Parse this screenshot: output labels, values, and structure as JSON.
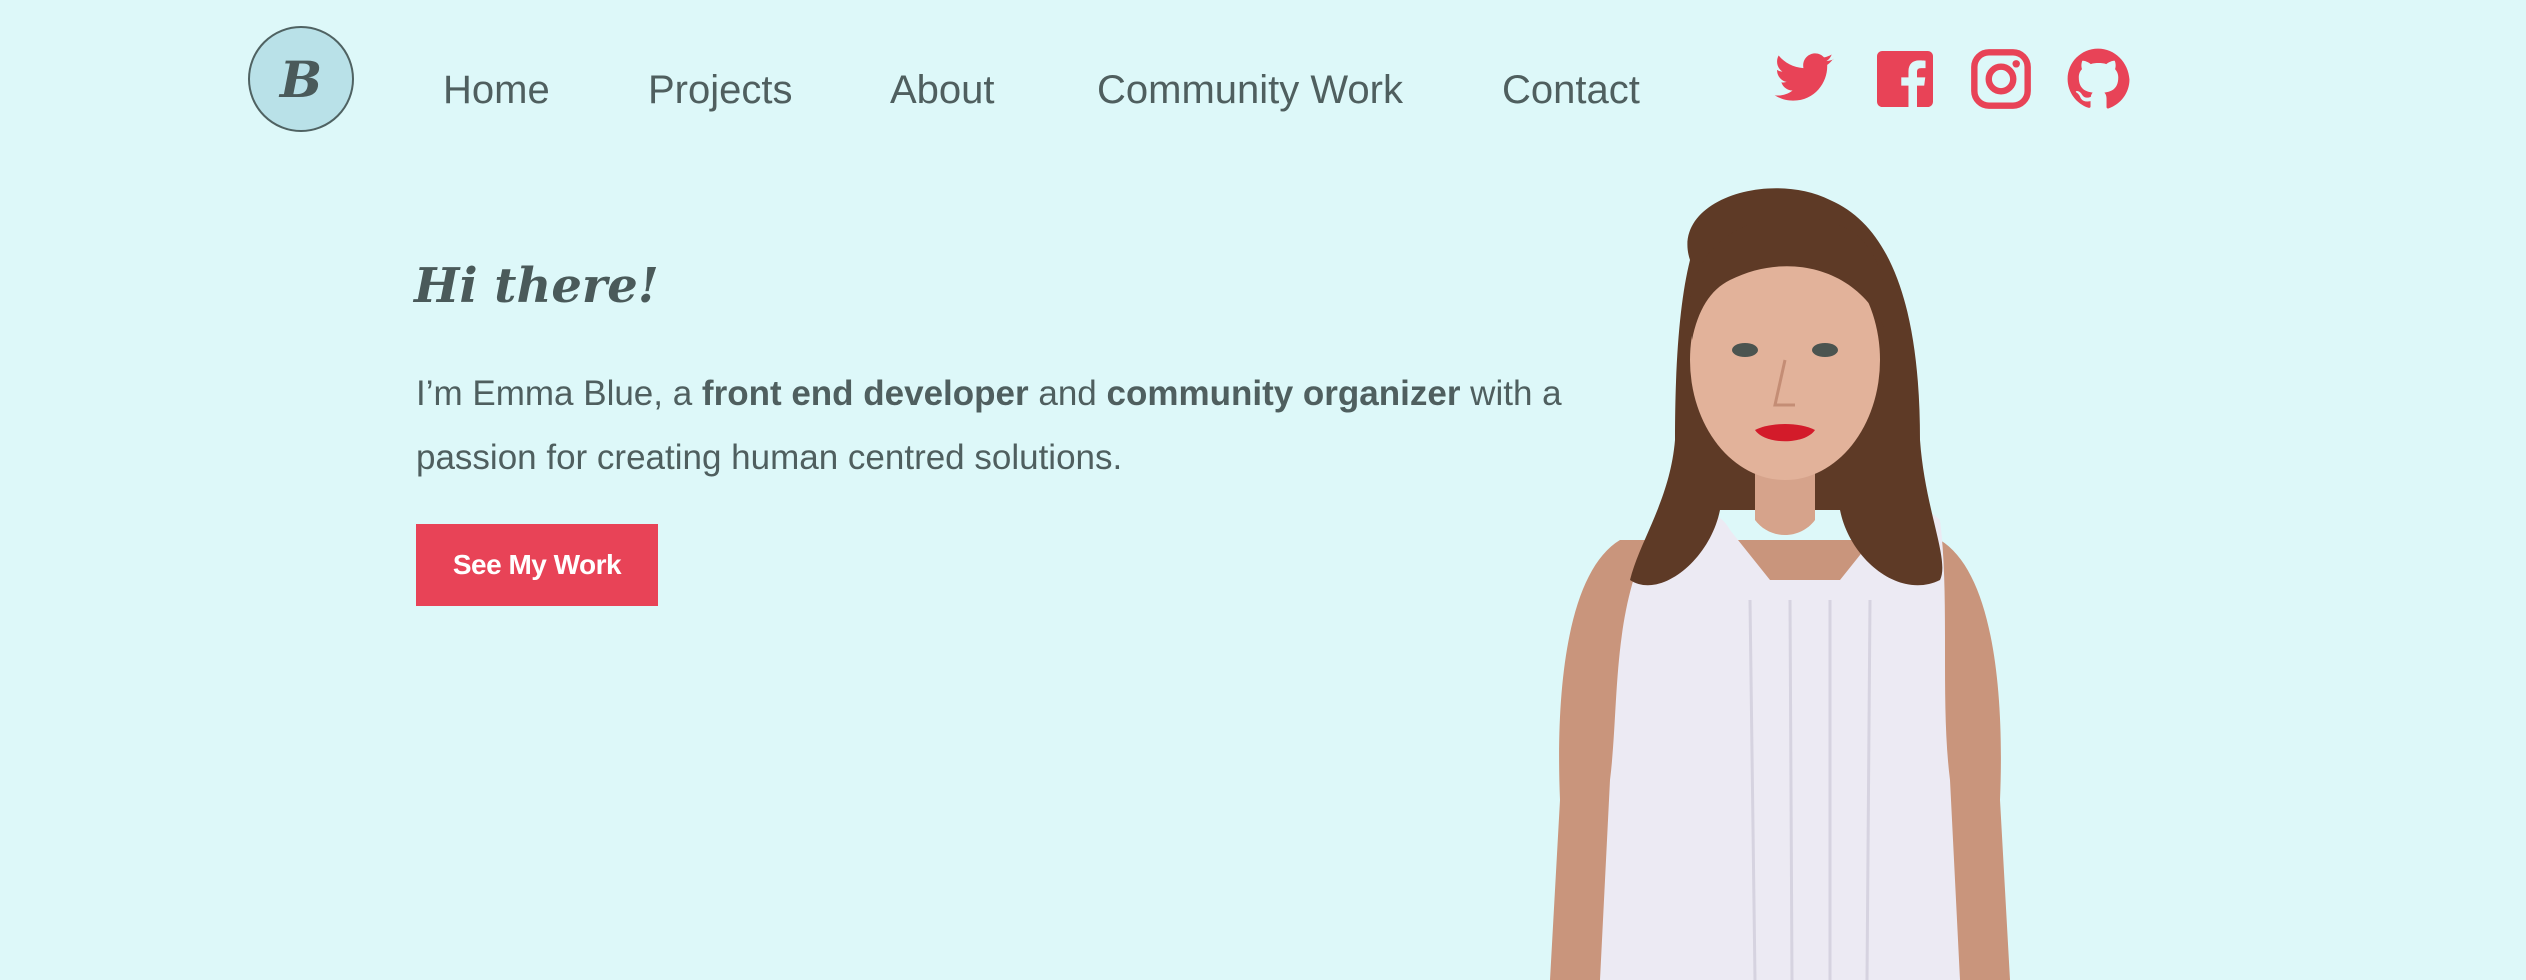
{
  "logo": {
    "letter": "B"
  },
  "nav": {
    "items": [
      {
        "label": "Home"
      },
      {
        "label": "Projects"
      },
      {
        "label": "About"
      },
      {
        "label": "Community Work"
      },
      {
        "label": "Contact"
      }
    ]
  },
  "social": {
    "accent_color": "#e84357",
    "icons": [
      "twitter-icon",
      "facebook-icon",
      "instagram-icon",
      "github-icon"
    ]
  },
  "hero": {
    "title": "Hi there!",
    "intro_prefix": "I’m Emma Blue, a ",
    "role_1": "front end developer",
    "joiner": " and ",
    "role_2": "community organizer",
    "intro_suffix": " with a passion for creating human centred solutions.",
    "cta_label": "See My Work"
  },
  "colors": {
    "background": "#ddf8f9",
    "text": "#4f5f5f",
    "accent": "#e84357",
    "logo_bg": "#b9e1e8"
  }
}
